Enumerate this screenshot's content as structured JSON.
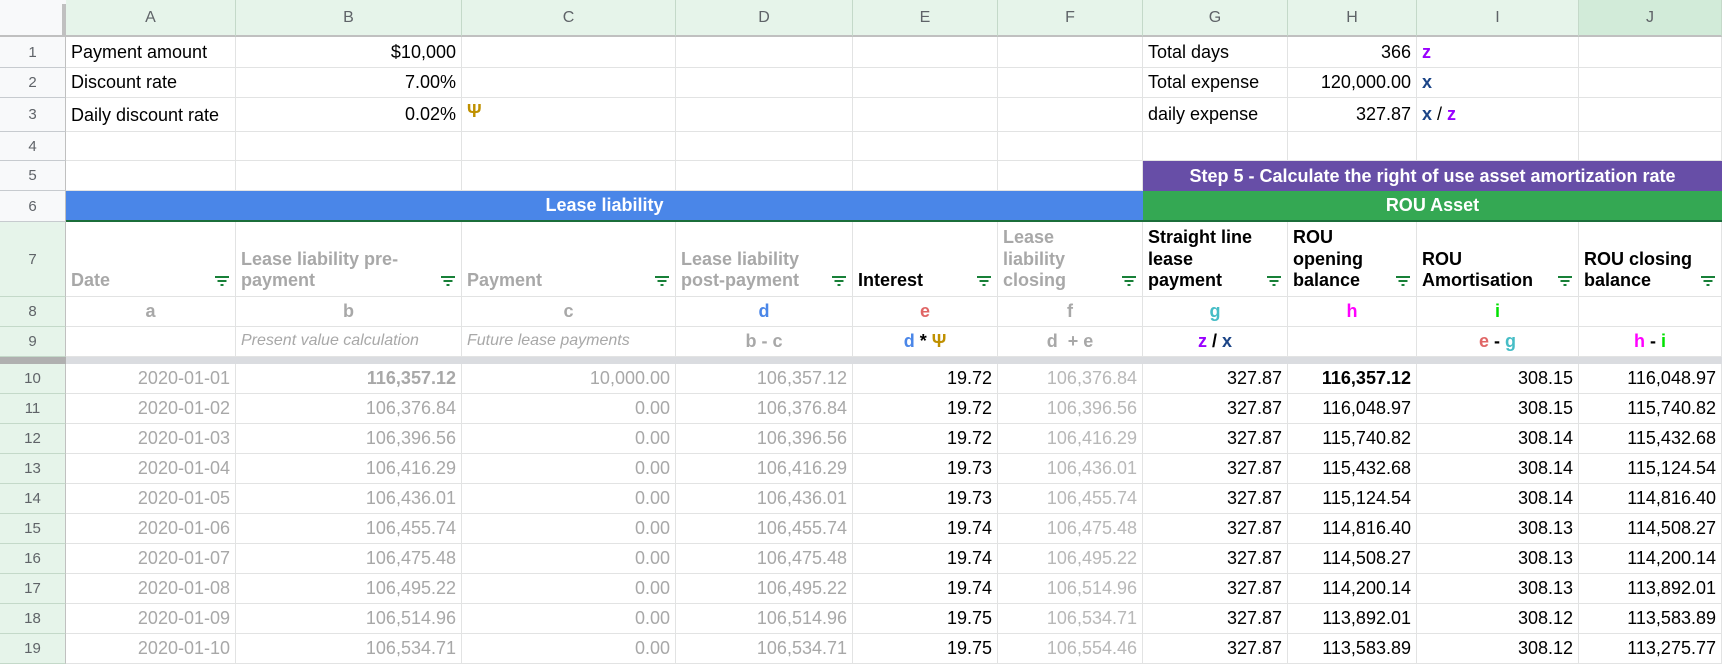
{
  "columns": [
    "A",
    "B",
    "C",
    "D",
    "E",
    "F",
    "G",
    "H",
    "I",
    "J"
  ],
  "selected_column": "J",
  "row_numbers": [
    "1",
    "2",
    "3",
    "4",
    "5",
    "6",
    "7",
    "8",
    "9",
    "10",
    "11",
    "12",
    "13",
    "14",
    "15",
    "16",
    "17",
    "18",
    "19"
  ],
  "inputs": {
    "payment_amount_label": "Payment amount",
    "payment_amount_value": "$10,000",
    "discount_rate_label": "Discount rate",
    "discount_rate_value": "7.00%",
    "daily_discount_rate_label": "Daily discount rate",
    "daily_discount_rate_value": "0.02%",
    "daily_discount_rate_symbol": "Ψ",
    "total_days_label": "Total days",
    "total_days_value": "366",
    "total_days_symbol": "z",
    "total_expense_label": "Total expense",
    "total_expense_value": "120,000.00",
    "total_expense_symbol": "x",
    "daily_expense_label": "daily expense",
    "daily_expense_value": "327.87",
    "daily_expense_formula": {
      "left": "x",
      "op": " / ",
      "right": "z"
    }
  },
  "bands": {
    "step5": "Step 5 - Calculate the right of use asset amortization rate",
    "lease_liability": "Lease liability",
    "rou_asset": "ROU Asset"
  },
  "colors": {
    "lease_band": "#4a86e8",
    "rou_band": "#34a853",
    "step_band": "#674ea7",
    "psi": "#bf9000",
    "z": "#9900ff",
    "x": "#1c4587",
    "d": "#4a86e8",
    "e": "#e06666",
    "g": "#46bdc6",
    "h": "#ff00ff",
    "i": "#00e000",
    "filter_icon": "#188038"
  },
  "headers": [
    {
      "col": "A",
      "label": "Date",
      "letter": "a",
      "formula": ""
    },
    {
      "col": "B",
      "label": "Lease liability pre-payment",
      "letter": "b",
      "formula": "Present value calculation"
    },
    {
      "col": "C",
      "label": "Payment",
      "letter": "c",
      "formula": "Future lease payments"
    },
    {
      "col": "D",
      "label": "Lease liability post-payment",
      "letter": "d",
      "formula": "b - c"
    },
    {
      "col": "E",
      "label": "Interest",
      "letter": "e",
      "formula": "d * Ψ"
    },
    {
      "col": "F",
      "label": "Lease liability closing",
      "letter": "f",
      "formula": "d  + e"
    },
    {
      "col": "G",
      "label": "Straight line lease payment",
      "letter": "g",
      "formula": "z / x"
    },
    {
      "col": "H",
      "label": "ROU opening balance",
      "letter": "h",
      "formula": ""
    },
    {
      "col": "I",
      "label": "ROU Amortisation",
      "letter": "i",
      "formula": "e - g"
    },
    {
      "col": "J",
      "label": "ROU closing balance",
      "letter": "",
      "formula": "h - i"
    }
  ],
  "rows": [
    [
      "2020-01-01",
      "116,357.12",
      "10,000.00",
      "106,357.12",
      "19.72",
      "106,376.84",
      "327.87",
      "116,357.12",
      "308.15",
      "116,048.97"
    ],
    [
      "2020-01-02",
      "106,376.84",
      "0.00",
      "106,376.84",
      "19.72",
      "106,396.56",
      "327.87",
      "116,048.97",
      "308.15",
      "115,740.82"
    ],
    [
      "2020-01-03",
      "106,396.56",
      "0.00",
      "106,396.56",
      "19.72",
      "106,416.29",
      "327.87",
      "115,740.82",
      "308.14",
      "115,432.68"
    ],
    [
      "2020-01-04",
      "106,416.29",
      "0.00",
      "106,416.29",
      "19.73",
      "106,436.01",
      "327.87",
      "115,432.68",
      "308.14",
      "115,124.54"
    ],
    [
      "2020-01-05",
      "106,436.01",
      "0.00",
      "106,436.01",
      "19.73",
      "106,455.74",
      "327.87",
      "115,124.54",
      "308.14",
      "114,816.40"
    ],
    [
      "2020-01-06",
      "106,455.74",
      "0.00",
      "106,455.74",
      "19.74",
      "106,475.48",
      "327.87",
      "114,816.40",
      "308.13",
      "114,508.27"
    ],
    [
      "2020-01-07",
      "106,475.48",
      "0.00",
      "106,475.48",
      "19.74",
      "106,495.22",
      "327.87",
      "114,508.27",
      "308.13",
      "114,200.14"
    ],
    [
      "2020-01-08",
      "106,495.22",
      "0.00",
      "106,495.22",
      "19.74",
      "106,514.96",
      "327.87",
      "114,200.14",
      "308.13",
      "113,892.01"
    ],
    [
      "2020-01-09",
      "106,514.96",
      "0.00",
      "106,514.96",
      "19.75",
      "106,534.71",
      "327.87",
      "113,892.01",
      "308.12",
      "113,583.89"
    ],
    [
      "2020-01-10",
      "106,534.71",
      "0.00",
      "106,534.71",
      "19.75",
      "106,554.46",
      "327.87",
      "113,583.89",
      "308.12",
      "113,275.77"
    ]
  ]
}
